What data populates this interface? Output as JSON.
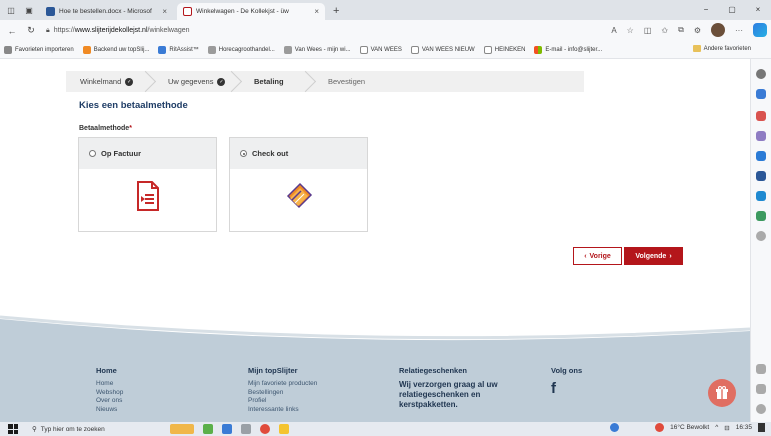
{
  "browser": {
    "tabs": [
      {
        "title": "Hoe te bestellen.docx - Microsof",
        "close": "×",
        "active": false
      },
      {
        "title": "Winkelwagen - De Kollekjst - üw",
        "close": "×",
        "active": true
      }
    ],
    "new_tab": "+",
    "url_prefix": "https://",
    "url_host": "www.slijterijdekollejst.nl",
    "url_path": "/winkelwagen",
    "window_controls": [
      "−",
      "▢",
      "×"
    ]
  },
  "bookmarks": [
    {
      "label": "Favorieten importeren",
      "color": "#888888"
    },
    {
      "label": "Backend uw topSlij...",
      "color": "#f08a24"
    },
    {
      "label": "RitAssist™",
      "color": "#3a7bd5"
    },
    {
      "label": "Horecagroothandel...",
      "color": "#9b9b9b"
    },
    {
      "label": "Van Wees - mijn wi...",
      "color": "#9b9b9b"
    },
    {
      "label": "VAN WEES",
      "color": "#9b9b9b"
    },
    {
      "label": "VAN WEES NIEUW",
      "color": "#9b9b9b"
    },
    {
      "label": "HEINEKEN",
      "color": "#9b9b9b"
    },
    {
      "label": "E-mail - info@slijter...",
      "color": "#f25022"
    }
  ],
  "bookmarks_other": "Andere favorieten",
  "steps": [
    {
      "label": "Winkelmand",
      "done": true
    },
    {
      "label": "Uw gegevens",
      "done": true
    },
    {
      "label": "Betaling",
      "done": false,
      "current": true
    },
    {
      "label": "Bevestigen",
      "done": false
    }
  ],
  "checkout": {
    "title": "Kies een betaalmethode",
    "field_label": "Betaalmethode",
    "required_mark": "*",
    "methods": [
      {
        "label": "Op Factuur",
        "selected": false,
        "icon": "invoice-icon"
      },
      {
        "label": "Check out",
        "selected": true,
        "icon": "card-wallet-icon"
      }
    ],
    "prev_label": "Vorige",
    "next_label": "Volgende",
    "accent": "#b4161b"
  },
  "footer": {
    "col1": {
      "title": "Home",
      "links": [
        "Home",
        "Webshop",
        "Over ons",
        "Nieuws"
      ]
    },
    "col2": {
      "title": "Mijn topSlijter",
      "links": [
        "Mijn favoriete producten",
        "Bestellingen",
        "Profiel",
        "Interessante links"
      ]
    },
    "col3": {
      "title": "Relatiegeschenken",
      "text": [
        "Wij verzorgen graag al uw",
        "relatiegeschenken en",
        "kerstpakketten."
      ]
    },
    "col4": {
      "title": "Volg ons",
      "social": "f"
    }
  },
  "taskbar": {
    "search_placeholder": "Typ hier om te zoeken",
    "weather": "16°C Bewolkt",
    "time": "16:35"
  }
}
